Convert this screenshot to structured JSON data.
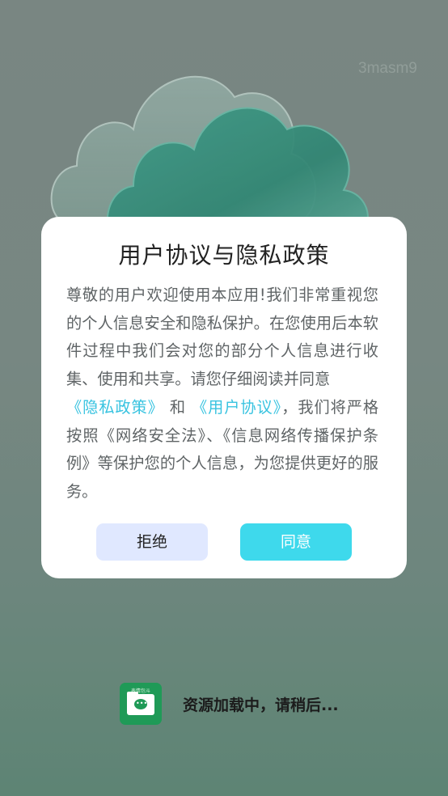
{
  "watermark": "3masm9",
  "dialog": {
    "title": "用户协议与隐私政策",
    "body_part1": "尊敬的用户欢迎使用本应用!我们非常重视您的个人信息安全和隐私保护。在您使用后本软件过程中我们会对您的部分个人信息进行收集、使用和共享。请您仔细阅读并同意",
    "privacy_link": "《隐私政策》",
    "connector": " 和 ",
    "user_agreement_link": "《用户协议》",
    "body_part2": "，我们将严格按照《网络安全法》、《信息网络传播保护条例》等保护您的个人信息，为您提供更好的服务。",
    "reject_label": "拒绝",
    "agree_label": "同意"
  },
  "loading": {
    "icon_caption": "表情包斗",
    "icon_glyph": "•••",
    "text": "资源加载中，请稍后..."
  },
  "colors": {
    "accent": "#3ed9ec",
    "link": "#38c3e0",
    "reject_bg": "#e0e8ff",
    "app_icon": "#1f9a57"
  }
}
